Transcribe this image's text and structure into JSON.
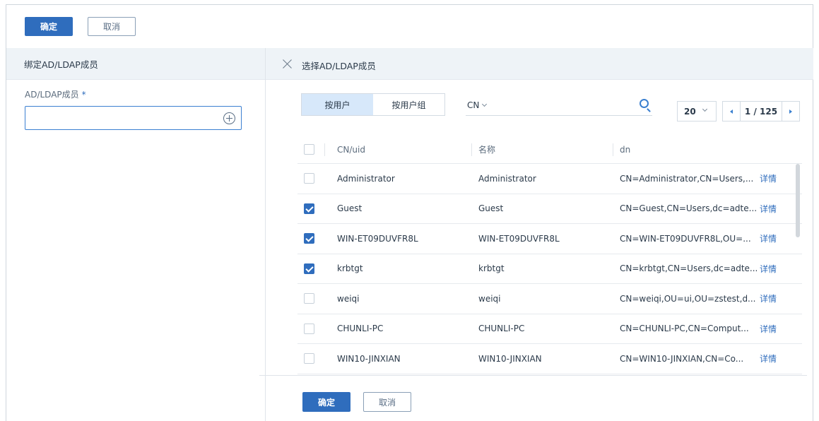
{
  "toolbar": {
    "ok_label": "确定",
    "cancel_label": "取消"
  },
  "left_panel": {
    "title": "绑定AD/LDAP成员",
    "field_label": "AD/LDAP成员",
    "required_mark": "*",
    "field_value": "",
    "add_icon": "plus-circle-icon"
  },
  "right_panel": {
    "title": "选择AD/LDAP成员",
    "tabs": [
      {
        "label": "按用户",
        "active": true
      },
      {
        "label": "按用户组",
        "active": false
      }
    ],
    "search_field": "CN",
    "page_size": "20",
    "page_info": "1 / 125",
    "columns": [
      "CN/uid",
      "名称",
      "dn"
    ],
    "rows": [
      {
        "checked": false,
        "uid": "Administrator",
        "name": "Administrator",
        "dn": "CN=Administrator,CN=Users,...",
        "action": "详情"
      },
      {
        "checked": true,
        "uid": "Guest",
        "name": "Guest",
        "dn": "CN=Guest,CN=Users,dc=adte...",
        "action": "详情"
      },
      {
        "checked": true,
        "uid": "WIN-ET09DUVFR8L",
        "name": "WIN-ET09DUVFR8L",
        "dn": "CN=WIN-ET09DUVFR8L,OU=...",
        "action": "详情"
      },
      {
        "checked": true,
        "uid": "krbtgt",
        "name": "krbtgt",
        "dn": "CN=krbtgt,CN=Users,dc=adte...",
        "action": "详情"
      },
      {
        "checked": false,
        "uid": "weiqi",
        "name": "weiqi",
        "dn": "CN=weiqi,OU=ui,OU=zstest,d...",
        "action": "详情"
      },
      {
        "checked": false,
        "uid": "CHUNLI-PC",
        "name": "CHUNLI-PC",
        "dn": "CN=CHUNLI-PC,CN=Comput...",
        "action": "详情"
      },
      {
        "checked": false,
        "uid": "WIN10-JINXIAN",
        "name": "WIN10-JINXIAN",
        "dn": "CN=WIN10-JINXIAN,CN=Co...",
        "action": "详情"
      }
    ],
    "footer": {
      "ok_label": "确定",
      "cancel_label": "取消"
    }
  },
  "colors": {
    "primary": "#2f6dbd",
    "header_bg": "#eef3f7",
    "tab_active_bg": "#d7e8fa"
  }
}
